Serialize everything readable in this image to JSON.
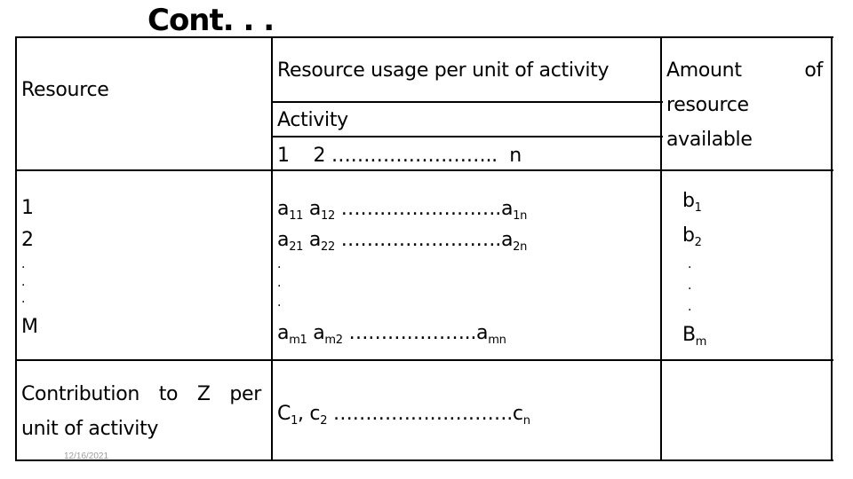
{
  "slide": {
    "title": "Cont. . .",
    "date": "12/16/2021"
  },
  "table": {
    "header": {
      "resource": "Resource",
      "usage": "Resource usage per unit of activity",
      "activity": "Activity",
      "activity_index": "1    2 ……………………..  n",
      "amount_line1_a": "Amount",
      "amount_line1_b": "of",
      "amount_line2": "resource",
      "amount_line3": "available"
    },
    "resource_rows": [
      "1",
      "2",
      ".",
      ".",
      ".",
      "M"
    ],
    "usage_rows": [
      {
        "a": "a",
        "a_sub": "11",
        "b": " a",
        "b_sub": "12",
        "dots": " …………………….",
        "c": "a",
        "c_sub": "1n"
      },
      {
        "a": "a",
        "a_sub": "21",
        "b": " a",
        "b_sub": "22",
        "dots": " …………………….",
        "c": "a",
        "c_sub": "2n"
      },
      {
        "dot": "."
      },
      {
        "dot": "."
      },
      {
        "dot": "."
      },
      {
        "a": "a",
        "a_sub": "m1",
        "b": " a",
        "b_sub": "m2",
        "dots": " ………………..",
        "c": "a",
        "c_sub": "mn"
      }
    ],
    "amount_rows": [
      {
        "base": "b",
        "sub": "1"
      },
      {
        "base": "b",
        "sub": "2"
      },
      {
        "dot": "."
      },
      {
        "dot": "."
      },
      {
        "dot": "."
      },
      {
        "base": "B",
        "sub": "m"
      }
    ],
    "contribution": {
      "label_line1_words": [
        "Contribution",
        "to",
        "Z",
        "per"
      ],
      "label_line2": "unit of activity",
      "c1": "C",
      "c1_sub": "1",
      "sep": ", c",
      "c2_sub": "2",
      "dots": " ……………………….",
      "cn": "c",
      "cn_sub": "n"
    }
  }
}
